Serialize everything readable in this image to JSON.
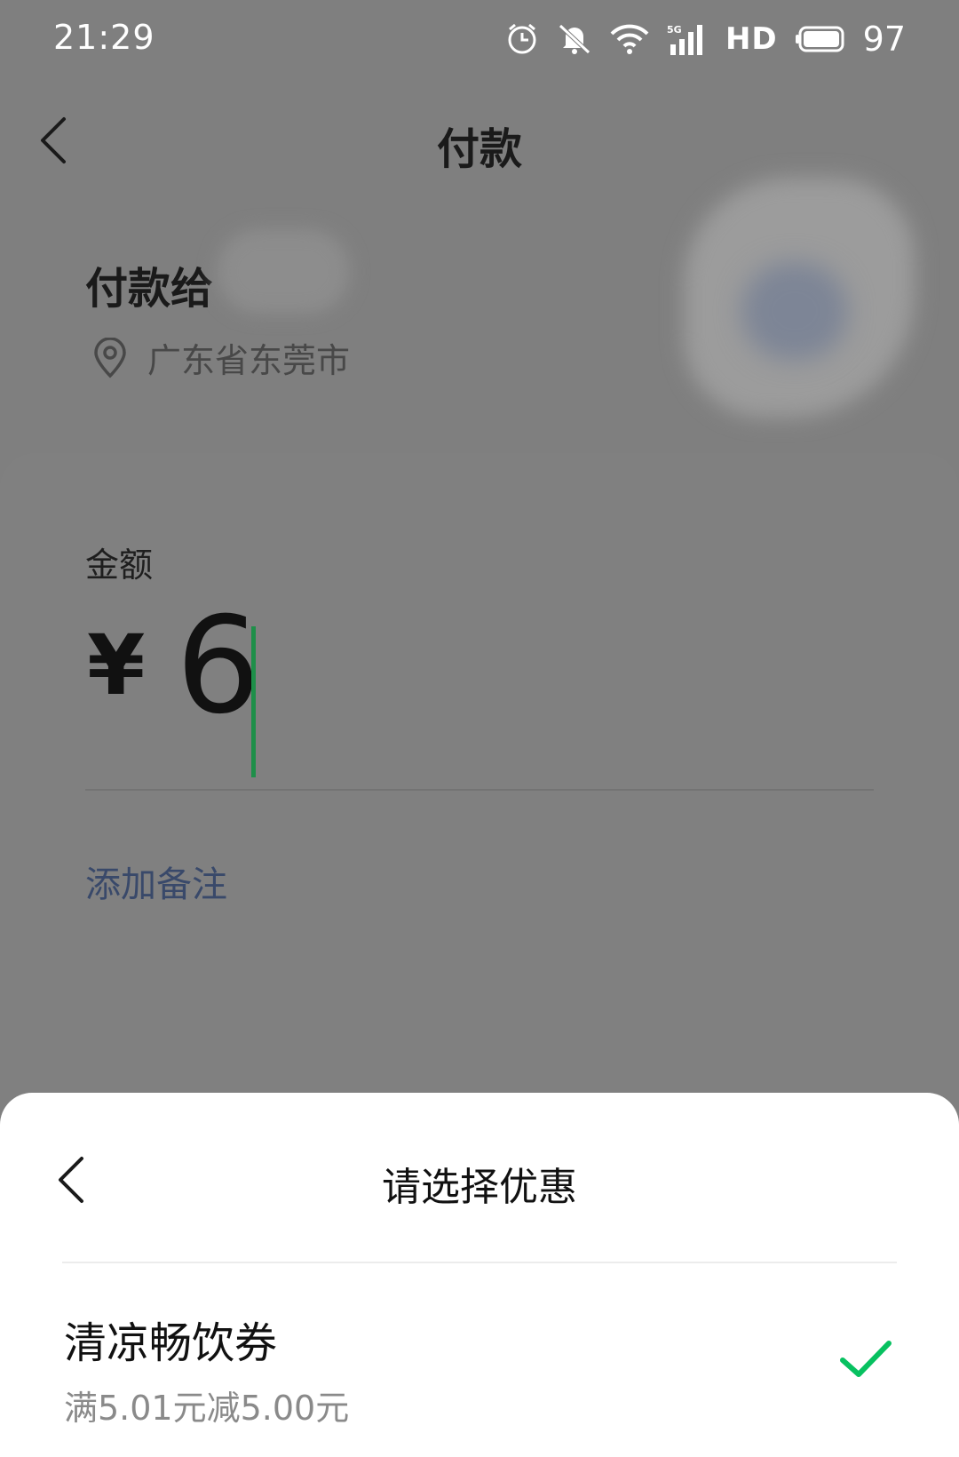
{
  "status_bar": {
    "time": "21:29",
    "network": "5G",
    "hd": "HD",
    "battery": "97"
  },
  "header": {
    "title": "付款"
  },
  "merchant": {
    "name_prefix": "付款给",
    "location": "广东省东莞市"
  },
  "amount": {
    "label": "金额",
    "currency": "¥",
    "value": "6",
    "add_remark": "添加备注"
  },
  "coupon_sheet": {
    "title": "请选择优惠",
    "items": [
      {
        "name": "清凉畅饮券",
        "desc": "满5.01元减5.00元",
        "selected": true
      }
    ]
  },
  "colors": {
    "accent": "#07c160",
    "link": "#39496a",
    "cursor": "#1e8f49"
  },
  "icons": [
    "chevron-left-icon",
    "location-pin-icon",
    "alarm-icon",
    "mute-icon",
    "wifi-icon",
    "signal-icon",
    "battery-icon",
    "check-icon"
  ]
}
